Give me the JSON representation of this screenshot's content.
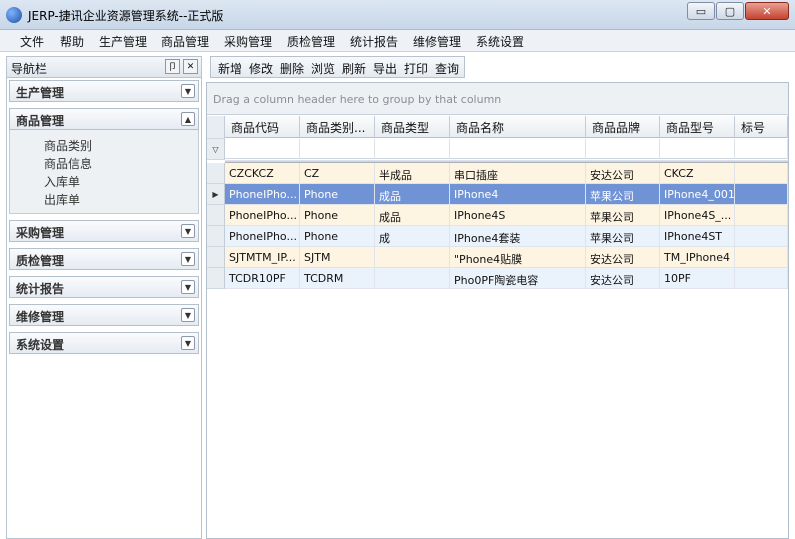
{
  "window": {
    "title": "JERP-捷讯企业资源管理系统--正式版",
    "controls": {
      "minimize": "▭",
      "maximize": "▢",
      "close": "✕"
    }
  },
  "menu": [
    "文件",
    "帮助",
    "生产管理",
    "商品管理",
    "采购管理",
    "质检管理",
    "统计报告",
    "维修管理",
    "系统设置"
  ],
  "sidebar": {
    "title": "导航栏",
    "pin": "卩",
    "close": "✕",
    "groups": [
      {
        "label": "生产管理",
        "expanded": false
      },
      {
        "label": "商品管理",
        "expanded": true,
        "items": [
          "商品类别",
          "商品信息",
          "入库单",
          "出库单"
        ]
      },
      {
        "label": "采购管理",
        "expanded": false
      },
      {
        "label": "质检管理",
        "expanded": false
      },
      {
        "label": "统计报告",
        "expanded": false
      },
      {
        "label": "维修管理",
        "expanded": false
      },
      {
        "label": "系统设置",
        "expanded": false
      }
    ]
  },
  "toolbar": [
    "新增",
    "修改",
    "删除",
    "浏览",
    "刷新",
    "导出",
    "打印",
    "查询"
  ],
  "grid": {
    "group_hint": "Drag a column header here to group by that column",
    "filter_icon": "▽",
    "columns": [
      "商品代码",
      "商品类别...",
      "商品类型",
      "商品名称",
      "商品品牌",
      "商品型号",
      "标号"
    ],
    "selected_row": 1,
    "rows": [
      [
        "CZCKCZ",
        "CZ",
        "半成品",
        "串口插座",
        "安达公司",
        "CKCZ",
        ""
      ],
      [
        "PhoneIPho...",
        "Phone",
        "成品",
        "IPhone4",
        "苹果公司",
        "IPhone4_001",
        ""
      ],
      [
        "PhoneIPho...",
        "Phone",
        "成品",
        "IPhone4S",
        "苹果公司",
        "IPhone4S_...",
        ""
      ],
      [
        "PhoneIPho...",
        "Phone",
        "成",
        "IPhone4套装",
        "苹果公司",
        "IPhone4ST",
        ""
      ],
      [
        "SJTMTM_IP...",
        "SJTM",
        "",
        "\"Phone4贴膜",
        "安达公司",
        "TM_IPhone4",
        ""
      ],
      [
        "TCDR10PF",
        "TCDRM",
        "",
        "Pho0PF陶瓷电容",
        "安达公司",
        "10PF",
        ""
      ]
    ]
  }
}
